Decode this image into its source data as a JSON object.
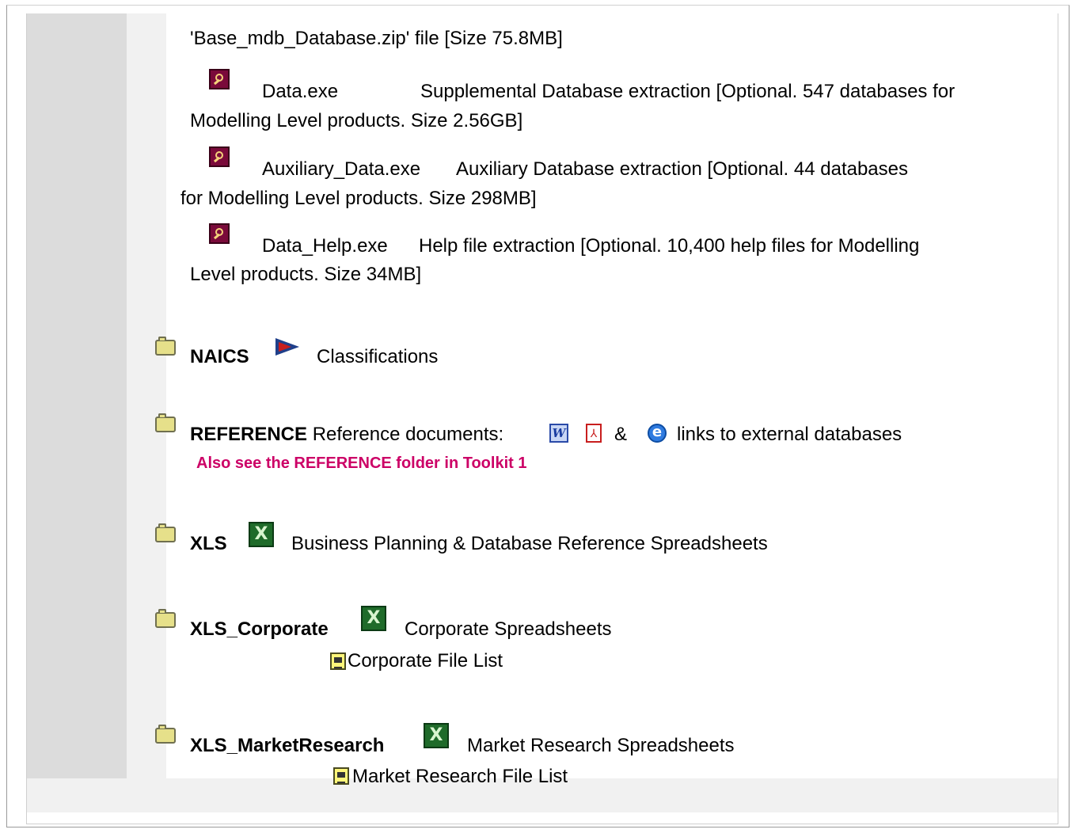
{
  "downloads": {
    "base_line": "'Base_mdb_Database.zip' file [Size 75.8MB]",
    "items": [
      {
        "name": "Data.exe",
        "line1": "Supplemental Database extraction [Optional. 547 databases for",
        "line2": "Modelling Level products. Size 2.56GB]"
      },
      {
        "name": "Auxiliary_Data.exe",
        "line1": "Auxiliary Database extraction [Optional. 44 databases",
        "line2": "for Modelling Level products. Size 298MB]"
      },
      {
        "name": "Data_Help.exe",
        "line1": "Help file extraction [Optional. 10,400 help files for Modelling",
        "line2": "Level products. Size 34MB]"
      }
    ]
  },
  "folders": {
    "naics": {
      "name": "NAICS",
      "desc": "Classifications"
    },
    "reference": {
      "name": "REFERENCE",
      "desc": "Reference documents:",
      "amp": "&",
      "desc2": "links to external databases",
      "note": "Also see the REFERENCE folder in Toolkit 1"
    },
    "xls": {
      "name": "XLS",
      "desc": "Business Planning & Database Reference Spreadsheets"
    },
    "xls_corporate": {
      "name": "XLS_Corporate",
      "desc": "Corporate Spreadsheets",
      "list": "Corporate File List"
    },
    "xls_market": {
      "name": "XLS_MarketResearch",
      "desc": "Market Research Spreadsheets",
      "list": "Market Research File List"
    }
  },
  "colors": {
    "accent_pink": "#cc0066",
    "left_col": "#dcdcdc"
  }
}
